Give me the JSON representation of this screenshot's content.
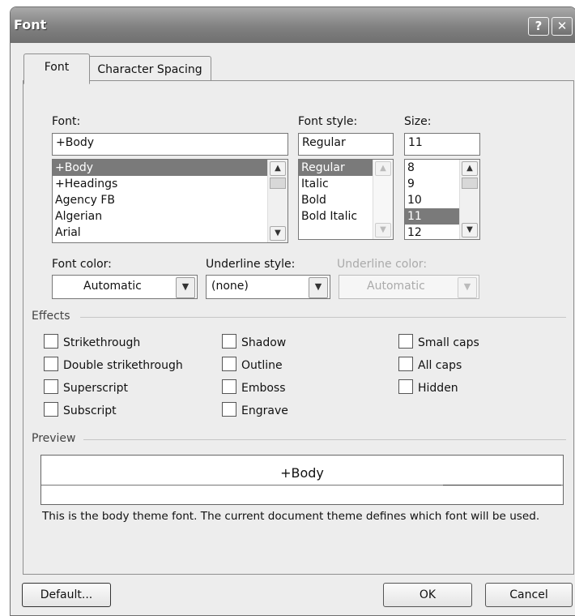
{
  "window": {
    "title": "Font",
    "help_glyph": "?",
    "close_glyph": "✕"
  },
  "tabs": [
    {
      "label": "Font"
    },
    {
      "label": "Character Spacing"
    }
  ],
  "font": {
    "label": "Font:",
    "value": "+Body",
    "items": [
      "+Body",
      "+Headings",
      "Agency FB",
      "Algerian",
      "Arial"
    ],
    "selected": "+Body"
  },
  "font_style": {
    "label": "Font style:",
    "value": "Regular",
    "items": [
      "Regular",
      "Italic",
      "Bold",
      "Bold Italic"
    ],
    "selected": "Regular"
  },
  "size": {
    "label": "Size:",
    "value": "11",
    "items": [
      "8",
      "9",
      "10",
      "11",
      "12"
    ],
    "selected": "11"
  },
  "font_color": {
    "label": "Font color:",
    "value": "Automatic"
  },
  "underline_style": {
    "label": "Underline style:",
    "value": "(none)"
  },
  "underline_color": {
    "label": "Underline color:",
    "value": "Automatic",
    "disabled": true
  },
  "effects": {
    "heading": "Effects",
    "items": [
      {
        "label": "Strikethrough",
        "checked": false
      },
      {
        "label": "Double strikethrough",
        "checked": false
      },
      {
        "label": "Superscript",
        "checked": false
      },
      {
        "label": "Subscript",
        "checked": false
      },
      {
        "label": "Shadow",
        "checked": false
      },
      {
        "label": "Outline",
        "checked": false
      },
      {
        "label": "Emboss",
        "checked": false
      },
      {
        "label": "Engrave",
        "checked": false
      },
      {
        "label": "Small caps",
        "checked": false
      },
      {
        "label": "All caps",
        "checked": false
      },
      {
        "label": "Hidden",
        "checked": false
      }
    ]
  },
  "preview": {
    "heading": "Preview",
    "sample": "+Body",
    "description": "This is the body theme font. The current document theme defines which font will be used."
  },
  "buttons": {
    "default": "Default...",
    "ok": "OK",
    "cancel": "Cancel"
  },
  "colors": {
    "selection": "#7a7a7a",
    "titlebar": "#818181",
    "dialog_bg": "#ededed"
  }
}
